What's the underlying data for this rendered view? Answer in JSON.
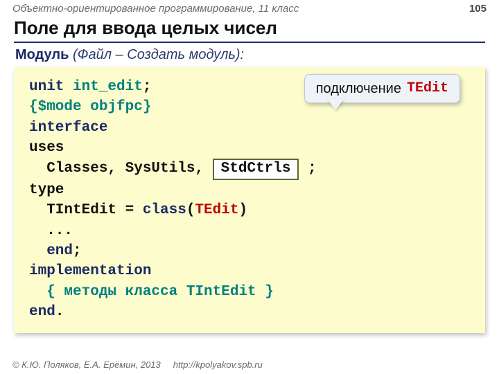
{
  "header": {
    "course": "Объектно-ориентированное программирование, 11 класс",
    "page": "105"
  },
  "title": "Поле для ввода целых чисел",
  "subtitle": {
    "module_word": "Модуль",
    "rest": " (Файл – Создать модуль):"
  },
  "callout": {
    "text": "подключение",
    "class_name": "TEdit"
  },
  "code": {
    "unit_kw": "unit",
    "unit_name": " int_edit",
    "semicolon": ";",
    "mode_directive": "{$mode objfpc}",
    "interface_kw": "interface",
    "uses_kw": "uses",
    "uses_list": "  Classes, SysUtils,",
    "stdctrls": "StdCtrls",
    "uses_end": " ;",
    "type_kw": "type",
    "type_decl_prefix": "  TIntEdit = ",
    "class_kw": "class",
    "class_paren_open": "(",
    "tedit": "TEdit",
    "class_paren_close": ")",
    "ellipsis": "  ...",
    "end_kw": "  end",
    "implementation_kw": "implementation",
    "impl_comment": "  { методы класса TIntEdit }",
    "end_dot": "end",
    "dot": "."
  },
  "footer": {
    "copyright": "© К.Ю. Поляков, Е.А. Ерёмин, 2013",
    "url": "http://kpolyakov.spb.ru"
  }
}
